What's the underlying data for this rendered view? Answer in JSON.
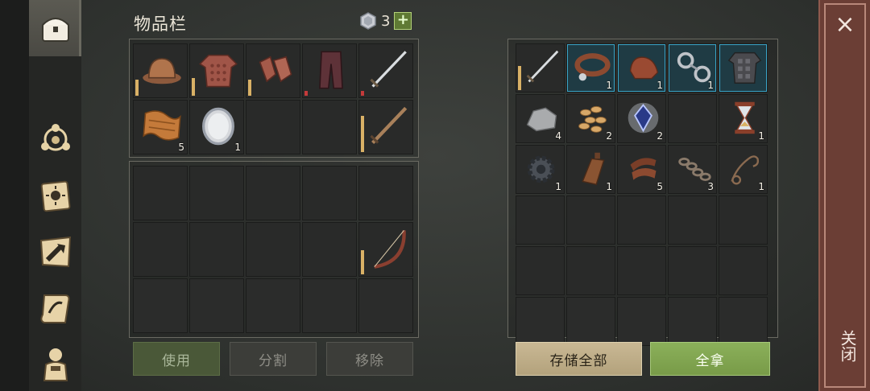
{
  "inventory": {
    "title": "物品栏",
    "gem_count": "3",
    "add_label": "+",
    "buttons": {
      "use": "使用",
      "split": "分割",
      "remove": "移除"
    }
  },
  "container": {
    "buttons": {
      "store_all": "存储全部",
      "take_all": "全拿"
    }
  },
  "close": {
    "x": "×",
    "label": "关闭"
  },
  "nav": [
    "chest-icon",
    "camp-icon",
    "journal-icon",
    "craft-map-icon",
    "scroll-icon",
    "character-icon"
  ],
  "inventory_slots": {
    "equip_row1": [
      {
        "name": "helmet",
        "qty": "",
        "durability": 0.45
      },
      {
        "name": "chainmail",
        "qty": "",
        "durability": 0.4
      },
      {
        "name": "gloves",
        "qty": "",
        "durability": 0.35
      },
      {
        "name": "leggings",
        "qty": "",
        "durability": 0.1,
        "low": true
      },
      {
        "name": "sword",
        "qty": "",
        "durability": 0.1,
        "low": true
      }
    ],
    "equip_row2": [
      {
        "name": "cloth",
        "qty": "5"
      },
      {
        "name": "mirror",
        "qty": "1"
      },
      {
        "name": "",
        "qty": ""
      },
      {
        "name": "",
        "qty": ""
      },
      {
        "name": "wooden-sword",
        "qty": "",
        "durability": 0.75
      }
    ],
    "bow_durability": 0.5
  },
  "container_slots": {
    "row1": [
      {
        "name": "sword",
        "qty": ""
      },
      {
        "name": "collar",
        "qty": "1"
      },
      {
        "name": "saddle",
        "qty": "1"
      },
      {
        "name": "shackles",
        "qty": "1"
      },
      {
        "name": "armor",
        "qty": ""
      }
    ],
    "row2": [
      {
        "name": "stone",
        "qty": "4"
      },
      {
        "name": "seeds",
        "qty": "2"
      },
      {
        "name": "crystal",
        "qty": "2"
      },
      {
        "name": "",
        "qty": ""
      },
      {
        "name": "hourglass",
        "qty": "1"
      }
    ],
    "row3": [
      {
        "name": "gear",
        "qty": "1"
      },
      {
        "name": "bottle",
        "qty": "1"
      },
      {
        "name": "leather",
        "qty": "5"
      },
      {
        "name": "chain",
        "qty": "3"
      },
      {
        "name": "rope",
        "qty": "1"
      }
    ]
  }
}
